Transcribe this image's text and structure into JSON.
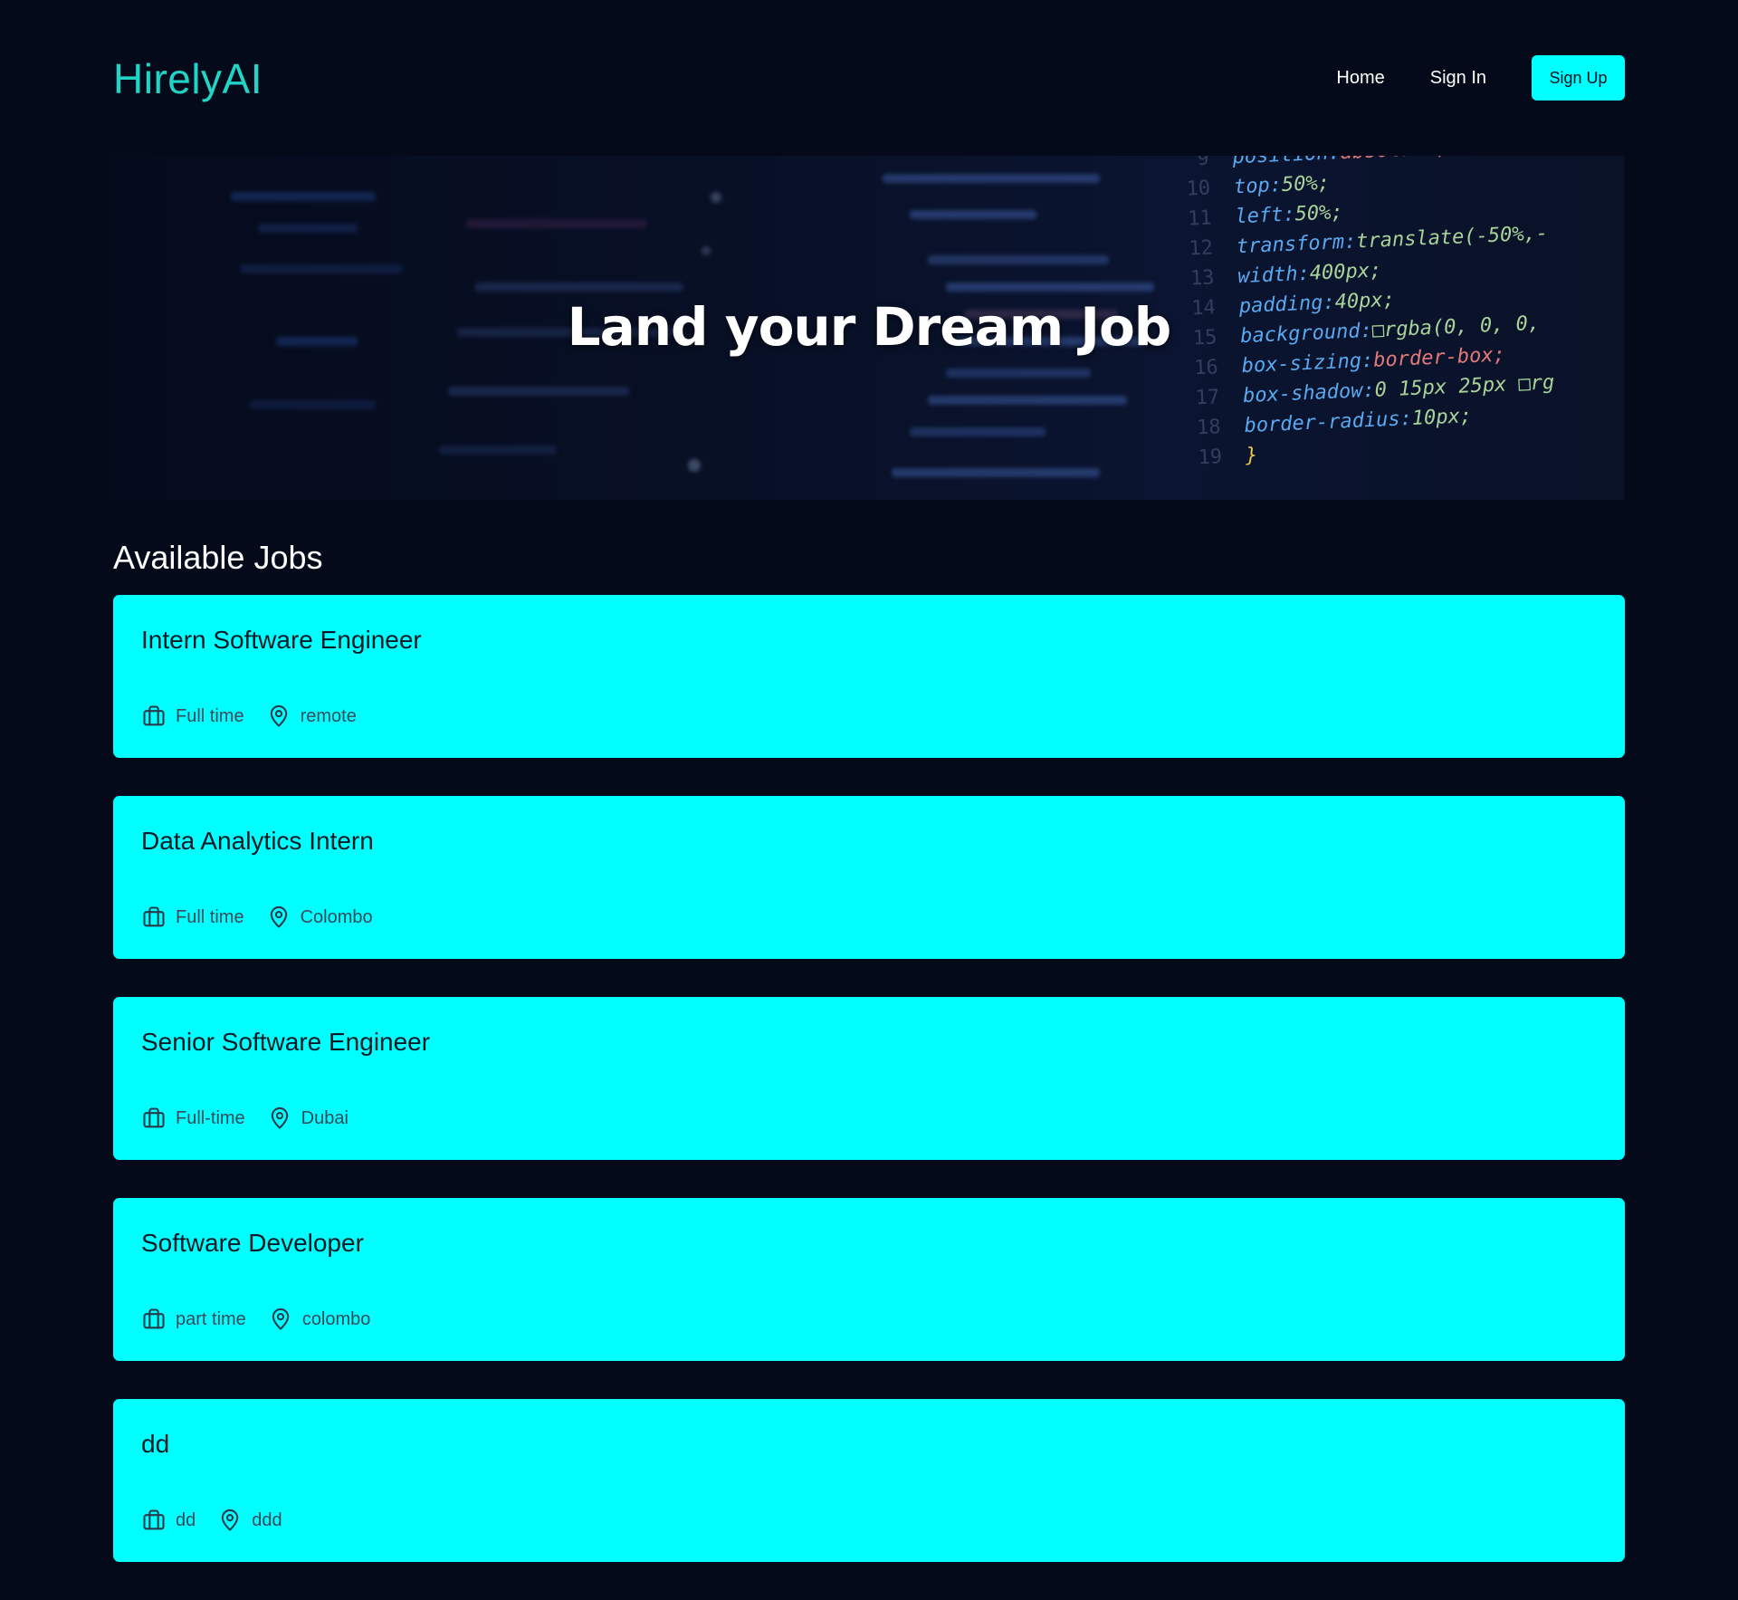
{
  "header": {
    "brand": "HirelyAI",
    "nav": {
      "home": "Home",
      "sign_in": "Sign In",
      "sign_up": "Sign Up"
    }
  },
  "hero": {
    "title": "Land your Dream Job",
    "code_lines": [
      {
        "num": "9",
        "prop": "position:",
        "val": "absolute;",
        "red": true
      },
      {
        "num": "10",
        "prop": "top:",
        "val": "50%;"
      },
      {
        "num": "11",
        "prop": "left:",
        "val": "50%;"
      },
      {
        "num": "12",
        "prop": "transform:",
        "val": "translate(-50%,-"
      },
      {
        "num": "13",
        "prop": "width:",
        "val": "400px;"
      },
      {
        "num": "14",
        "prop": "padding:",
        "val": "40px;"
      },
      {
        "num": "15",
        "prop": "background:",
        "val": "□rgba(0, 0, 0,"
      },
      {
        "num": "16",
        "prop": "box-sizing:",
        "val": "border-box;",
        "red": true
      },
      {
        "num": "17",
        "prop": "box-shadow:",
        "val": "0 15px 25px □rg"
      },
      {
        "num": "18",
        "prop": "border-radius:",
        "val": "10px;"
      },
      {
        "num": "19",
        "prop": "}",
        "val": "",
        "brace": true
      }
    ]
  },
  "jobs_section": {
    "title": "Available Jobs",
    "jobs": [
      {
        "title": "Intern Software Engineer",
        "type": "Full time",
        "location": "remote"
      },
      {
        "title": "Data Analytics Intern",
        "type": "Full time",
        "location": "Colombo"
      },
      {
        "title": "Senior Software Engineer",
        "type": "Full-time",
        "location": "Dubai"
      },
      {
        "title": "Software Developer",
        "type": "part time",
        "location": "colombo"
      },
      {
        "title": "dd",
        "type": "dd",
        "location": "ddd"
      }
    ],
    "icons": {
      "type_icon": "briefcase-icon",
      "location_icon": "map-pin-icon"
    }
  },
  "colors": {
    "background": "#040a1a",
    "brand": "#22d4c6",
    "accent": "#00ffff"
  }
}
